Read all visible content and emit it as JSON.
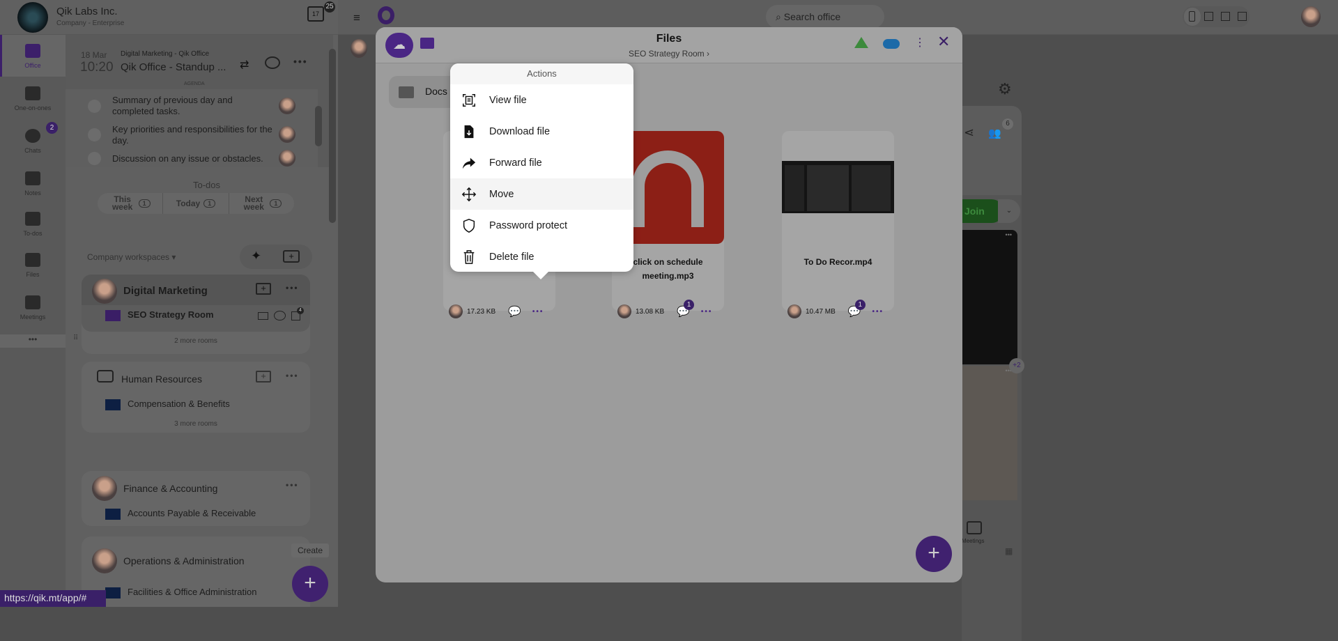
{
  "company": {
    "name": "Qik Labs Inc.",
    "plan": "Company - Enterprise",
    "calendar_day": "17",
    "calendar_badge": "25"
  },
  "rail": [
    {
      "label": "Office",
      "icon": "briefcase-icon"
    },
    {
      "label": "One-on-ones",
      "icon": "people-icon"
    },
    {
      "label": "Chats",
      "icon": "chat-icon",
      "badge": "2"
    },
    {
      "label": "Notes",
      "icon": "notes-icon"
    },
    {
      "label": "To-dos",
      "icon": "checkbox-icon"
    },
    {
      "label": "Files",
      "icon": "files-icon"
    },
    {
      "label": "Meetings",
      "icon": "meetings-icon"
    }
  ],
  "rail_more": "•••",
  "meeting": {
    "date": "18 Mar",
    "time": "10:20",
    "context": "Digital Marketing - Qik Office",
    "title": "Qik Office - Standup ...",
    "agenda_label": "AGENDA",
    "agenda": [
      "Summary of previous day and completed tasks.",
      "Key priorities and responsibilities for the day.",
      "Discussion on any issue or obstacles."
    ]
  },
  "todos": {
    "title": "To-dos",
    "tabs": [
      {
        "label": "This week",
        "count": "1"
      },
      {
        "label": "Today",
        "count": "1"
      },
      {
        "label": "Next week",
        "count": "1"
      }
    ]
  },
  "workspaces": {
    "selector": "Company workspaces",
    "items": [
      {
        "name": "Digital Marketing",
        "room": "SEO Strategy Room",
        "room_badge": "4",
        "more": "2 more rooms"
      },
      {
        "name": "Human Resources",
        "room": "Compensation & Benefits",
        "more": "3 more rooms"
      },
      {
        "name": "Finance & Accounting",
        "room": "Accounts Payable & Receivable"
      },
      {
        "name": "Operations & Administration",
        "room": "Facilities & Office Administration"
      }
    ]
  },
  "create_tooltip": "Create",
  "status_url": "https://qik.mt/app/#",
  "search": {
    "placeholder": "Search office"
  },
  "files": {
    "title": "Files",
    "breadcrumb": "SEO Strategy Room ›",
    "folder": "Docs",
    "cards": [
      {
        "name": "",
        "size": "17.23 KB"
      },
      {
        "name": "click on schedule meeting.mp3",
        "size": "13.08 KB",
        "comments": "1"
      },
      {
        "name": "To Do Recor.mp4",
        "size": "10.47 MB",
        "comments": "1"
      }
    ]
  },
  "actions": {
    "title": "Actions",
    "items": [
      {
        "label": "View file",
        "icon": "view-file-icon"
      },
      {
        "label": "Download file",
        "icon": "download-file-icon"
      },
      {
        "label": "Forward file",
        "icon": "forward-icon"
      },
      {
        "label": "Move",
        "icon": "move-icon"
      },
      {
        "label": "Password protect",
        "icon": "shield-icon"
      },
      {
        "label": "Delete file",
        "icon": "trash-icon"
      }
    ]
  },
  "right": {
    "participants": "6",
    "join": "Join",
    "more_participants": "+2",
    "meetings": "Meetings"
  },
  "colors": {
    "accent": "#5b2fa0",
    "join": "#1f7a1f",
    "audio_thumb": "#8c1f16"
  }
}
